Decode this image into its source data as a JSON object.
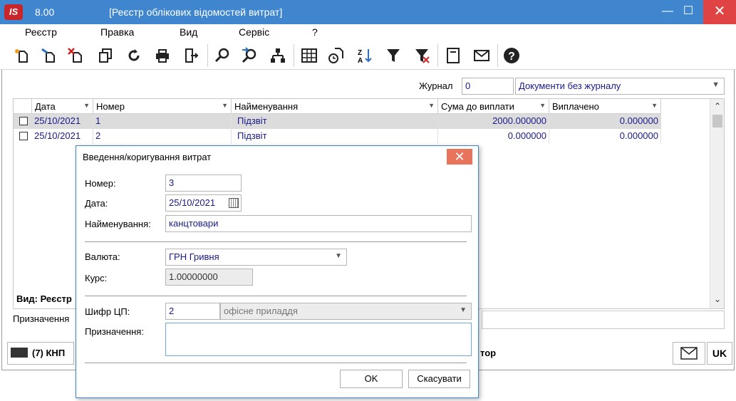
{
  "window": {
    "version": "8.00",
    "title": "[Реєстр облікових відомостей витрат]",
    "logo": "IS",
    "minimize": "—",
    "maximize": "☐",
    "close": "✕"
  },
  "menu": [
    "Реєстр",
    "Правка",
    "Вид",
    "Сервіс",
    "?"
  ],
  "toolbar_icons": [
    "new-icon",
    "copy-new-icon",
    "delete-icon",
    "duplicate-icon",
    "refresh-icon",
    "print-icon",
    "export-icon",
    "search-icon",
    "search-next-icon",
    "hierarchy-icon",
    "table-icon",
    "history-icon",
    "sort-icon",
    "filter-icon",
    "filter-clear-icon",
    "form-icon",
    "mail-icon",
    "help-icon"
  ],
  "journal": {
    "label": "Журнал",
    "code": "0",
    "name": "Документи без журналу"
  },
  "table": {
    "headers": [
      "Дата",
      "Номер",
      "Найменування",
      "Сума до виплати",
      "Виплачено"
    ],
    "rows": [
      {
        "date": "25/10/2021",
        "number": "1",
        "name": "Підзвіт",
        "sum": "2000.000000",
        "paid": "0.000000"
      },
      {
        "date": "25/10/2021",
        "number": "2",
        "name": "Підзвіт",
        "sum": "0.000000",
        "paid": "0.000000"
      }
    ]
  },
  "view_label": "Вид: Реєстр",
  "purpose_label": "Призначення",
  "status": {
    "company": "(7) КНП",
    "operator": "тор",
    "lang": "UK"
  },
  "dialog": {
    "title": "Введення/коригування витрат",
    "close": "✕",
    "number_label": "Номер:",
    "number": "3",
    "date_label": "Дата:",
    "date": "25/10/2021",
    "name_label": "Найменування:",
    "name": "канцтовари",
    "currency_label": "Валюта:",
    "currency": "ГРН Гривня",
    "rate_label": "Курс:",
    "rate": "1.00000000",
    "cp_label": "Шифр ЦП:",
    "cp_code": "2",
    "cp_name": "офісне приладдя",
    "purpose_label": "Призначення:",
    "purpose": "",
    "ok": "OK",
    "cancel": "Скасувати"
  }
}
